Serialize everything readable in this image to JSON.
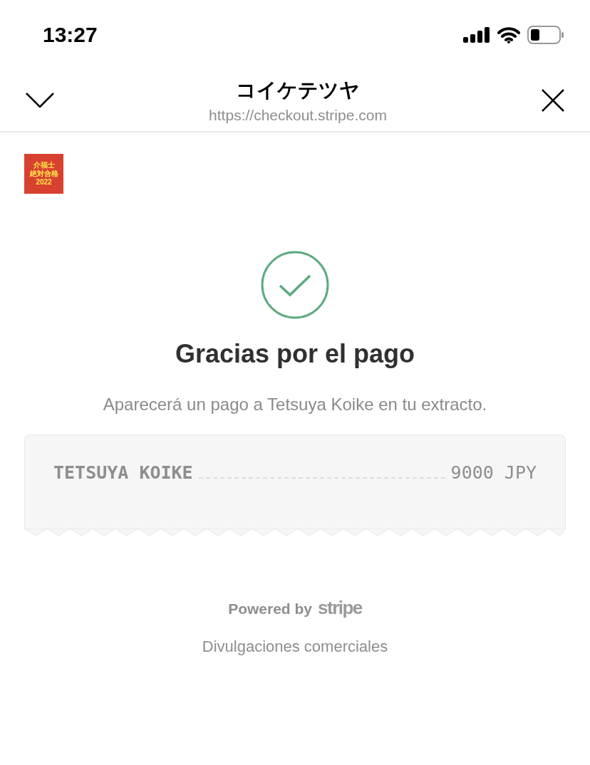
{
  "status_bar": {
    "time": "13:27"
  },
  "header": {
    "title": "コイケテツヤ",
    "url": "https://checkout.stripe.com"
  },
  "merchant_logo": {
    "lines": [
      "介福士",
      "絶対合格",
      "2022"
    ]
  },
  "confirmation": {
    "title": "Gracias por el pago",
    "message": "Aparecerá un pago a Tetsuya Koike en tu extracto."
  },
  "receipt": {
    "descriptor": "TETSUYA KOIKE",
    "amount": "9000 JPY"
  },
  "footer": {
    "powered_by": "Powered by",
    "brand": "stripe",
    "link": "Divulgaciones comerciales"
  }
}
